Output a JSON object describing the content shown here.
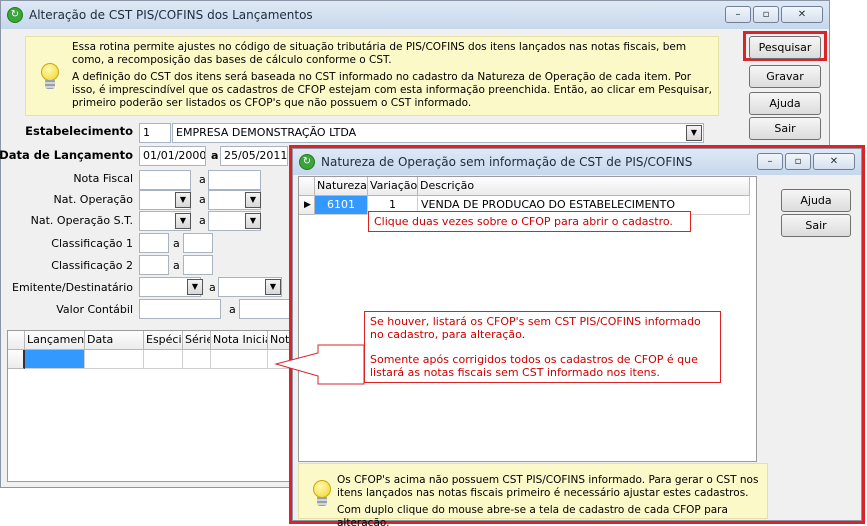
{
  "main": {
    "title": "Alteração de CST PIS/COFINS dos Lançamentos",
    "window_controls": [
      "–",
      "▫",
      "✕"
    ],
    "info": {
      "paragraph1": "Essa rotina permite ajustes no código de situação tributária de PIS/COFINS dos itens lançados nas notas fiscais, bem como, a recomposição das bases de cálculo conforme o CST.",
      "paragraph2": "A definição do CST dos itens será baseada no CST informado no cadastro da Natureza de Operação de cada item. Por isso, é imprescindível que os cadastros de CFOP estejam com esta informação preenchida. Então, ao clicar em Pesquisar, primeiro poderão ser listados os CFOP's que não possuem o CST informado."
    },
    "buttons": {
      "pesquisar": "Pesquisar",
      "gravar": "Gravar",
      "ajuda": "Ajuda",
      "sair": "Sair"
    },
    "form": {
      "estabelecimento_label": "Estabelecimento",
      "estabelecimento_code": "1",
      "estabelecimento_name": "EMPRESA DEMONSTRAÇÃO LTDA",
      "data_label": "Data de Lançamento",
      "data_from": "01/01/2000",
      "data_to": "25/05/2011",
      "a": "a",
      "nota_fiscal_label": "Nota Fiscal",
      "nat_operacao_label": "Nat. Operação",
      "nat_operacao_st_label": "Nat. Operação S.T.",
      "classificacao1_label": "Classificação 1",
      "classificacao2_label": "Classificação 2",
      "emitente_label": "Emitente/Destinatário",
      "valor_contabil_label": "Valor Contábil"
    },
    "grid_headers": [
      "Lançamento",
      "Data",
      "Espécie",
      "Série",
      "Nota Inicial",
      "Nota"
    ]
  },
  "dialog": {
    "title": "Natureza de Operação sem informação de CST de PIS/COFINS",
    "window_controls": [
      "–",
      "▫",
      "✕"
    ],
    "grid_headers": [
      "Natureza",
      "Variação",
      "Descrição"
    ],
    "row": {
      "natureza": "6101",
      "variacao": "1",
      "descricao": "VENDA DE PRODUCAO DO ESTABELECIMENTO"
    },
    "buttons": {
      "ajuda": "Ajuda",
      "sair": "Sair"
    },
    "hint": "Clique duas vezes sobre o CFOP para abrir o cadastro.",
    "info": {
      "paragraph1": "Os CFOP's acima não possuem CST PIS/COFINS informado. Para gerar o CST nos itens lançados nas notas fiscais primeiro é necessário ajustar estes cadastros.",
      "paragraph2": "Com duplo clique do mouse abre-se a tela de cadastro de cada CFOP para alteração."
    }
  },
  "callout": {
    "paragraph1": "Se houver, listará os CFOP's sem CST PIS/COFINS informado no cadastro, para alteração.",
    "paragraph2": "Somente após corrigidos todos os cadastros de CFOP é que listará as notas fiscais sem CST informado nos itens."
  },
  "colors": {
    "highlight": "#d9242a",
    "selected_cell": "#3399ff",
    "info_bg": "#fbf9c8"
  }
}
